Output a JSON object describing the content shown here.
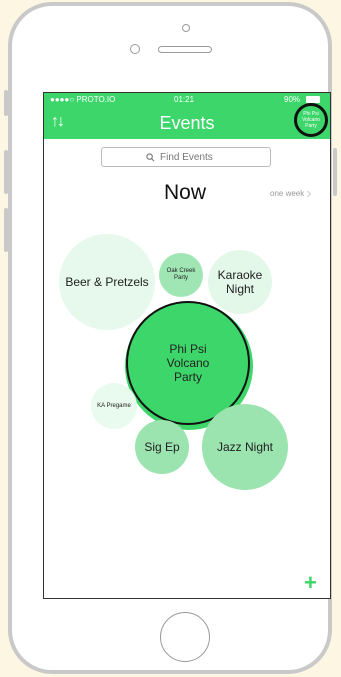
{
  "status": {
    "carrier": "●●●●○ PROTO.IO",
    "time": "01:21",
    "battery": "90%"
  },
  "nav": {
    "sort_icon": "↑↓",
    "title": "Events",
    "featured_bubble": "Phi Psi Volcano Party"
  },
  "search": {
    "placeholder": "Find Events"
  },
  "timeframe": {
    "current": "Now",
    "next_label": "one week",
    "next_chevron": "›"
  },
  "events": {
    "beer": "Beer & Pretzels",
    "oak": "Oak Creek Party",
    "karaoke": "Karaoke Night",
    "phi": "Phi Psi Volcano Party",
    "ka": "KA Pregame",
    "sig": "Sig Ep",
    "jazz": "Jazz Night"
  },
  "actions": {
    "add": "+"
  },
  "colors": {
    "accent": "#3dd66a",
    "bubble_light": "#e6f9ec",
    "bubble_mid": "#9be4b0"
  }
}
